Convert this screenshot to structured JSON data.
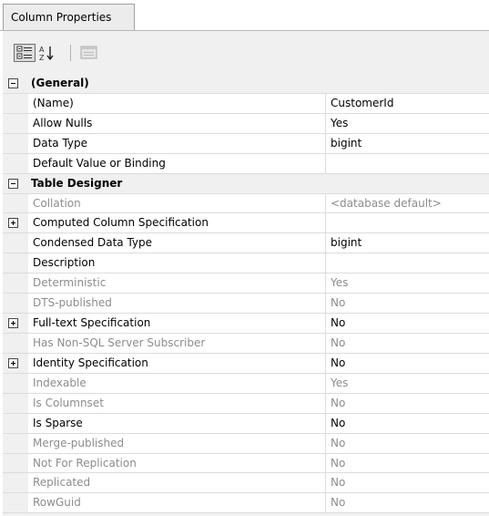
{
  "tab": {
    "label": "Column Properties"
  },
  "toolbar": {
    "categorized_icon": "categorized-icon",
    "alphabetical_icon": "alphabetical-sort-icon",
    "property_pages_icon": "property-pages-icon"
  },
  "rows": [
    {
      "type": "category",
      "name": "(General)",
      "expanded": true
    },
    {
      "type": "property",
      "name": "(Name)",
      "value": "CustomerId",
      "dim": false
    },
    {
      "type": "property",
      "name": "Allow Nulls",
      "value": "Yes",
      "dim": false
    },
    {
      "type": "property",
      "name": "Data Type",
      "value": "bigint",
      "dim": false
    },
    {
      "type": "property",
      "name": "Default Value or Binding",
      "value": "",
      "dim": false
    },
    {
      "type": "category",
      "name": "Table Designer",
      "expanded": true
    },
    {
      "type": "property",
      "name": "Collation",
      "value": "<database default>",
      "dim": true
    },
    {
      "type": "property",
      "name": "Computed Column Specification",
      "value": "",
      "dim": false,
      "expandable": true
    },
    {
      "type": "property",
      "name": "Condensed Data Type",
      "value": "bigint",
      "dim": false
    },
    {
      "type": "property",
      "name": "Description",
      "value": "",
      "dim": false
    },
    {
      "type": "property",
      "name": "Deterministic",
      "value": "Yes",
      "dim": true
    },
    {
      "type": "property",
      "name": "DTS-published",
      "value": "No",
      "dim": true
    },
    {
      "type": "property",
      "name": "Full-text Specification",
      "value": "No",
      "dim": false,
      "expandable": true
    },
    {
      "type": "property",
      "name": "Has Non-SQL Server Subscriber",
      "value": "No",
      "dim": true
    },
    {
      "type": "property",
      "name": "Identity Specification",
      "value": "No",
      "dim": false,
      "expandable": true
    },
    {
      "type": "property",
      "name": "Indexable",
      "value": "Yes",
      "dim": true
    },
    {
      "type": "property",
      "name": "Is Columnset",
      "value": "No",
      "dim": true
    },
    {
      "type": "property",
      "name": "Is Sparse",
      "value": "No",
      "dim": false
    },
    {
      "type": "property",
      "name": "Merge-published",
      "value": "No",
      "dim": true
    },
    {
      "type": "property",
      "name": "Not For Replication",
      "value": "No",
      "dim": true
    },
    {
      "type": "property",
      "name": "Replicated",
      "value": "No",
      "dim": true
    },
    {
      "type": "property",
      "name": "RowGuid",
      "value": "No",
      "dim": true
    }
  ]
}
